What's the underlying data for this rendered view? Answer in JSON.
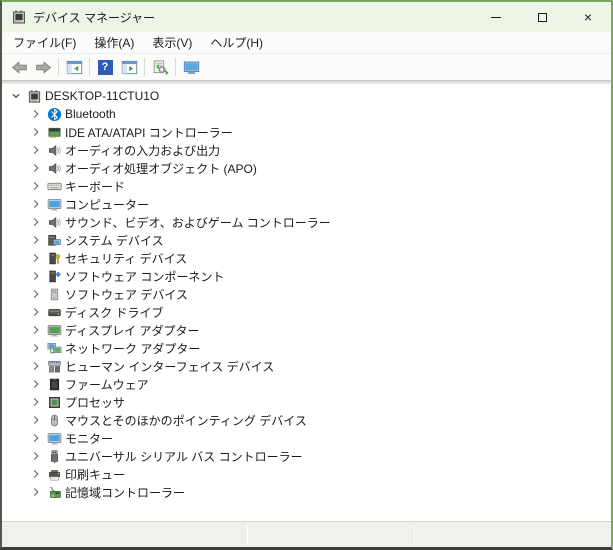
{
  "window": {
    "title": "デバイス マネージャー",
    "controls": {
      "minimize": "minimize",
      "maximize": "maximize",
      "close": "close"
    },
    "colors": {
      "border_green": "#7aa85a",
      "titlebar_bg": "#edf5e6",
      "tree_bg": "#ffffff",
      "statusbar_bg": "#f0f0ec",
      "text": "#1b1b1b",
      "bluetooth_blue": "#0078d4",
      "help_blue": "#2f5bb7"
    }
  },
  "menu": {
    "items": [
      {
        "name": "file",
        "label": "ファイル(F)"
      },
      {
        "name": "action",
        "label": "操作(A)"
      },
      {
        "name": "view",
        "label": "表示(V)"
      },
      {
        "name": "help",
        "label": "ヘルプ(H)"
      }
    ]
  },
  "toolbar": {
    "groups": [
      {
        "buttons": [
          {
            "name": "back",
            "icon": "nav-back"
          },
          {
            "name": "forward",
            "icon": "nav-forward"
          }
        ]
      },
      {
        "buttons": [
          {
            "name": "show-console-tree",
            "icon": "panel-left"
          }
        ]
      },
      {
        "buttons": [
          {
            "name": "help",
            "icon": "help"
          },
          {
            "name": "show-action-pane",
            "icon": "panel-right"
          }
        ]
      },
      {
        "buttons": [
          {
            "name": "scan-hardware-changes",
            "icon": "scan"
          }
        ]
      },
      {
        "buttons": [
          {
            "name": "computer",
            "icon": "remote-monitor"
          }
        ]
      }
    ]
  },
  "tree": {
    "root": {
      "name": "desktop-root",
      "label": "DESKTOP-11CTU1O",
      "icon": "computer-device",
      "expanded": true
    },
    "items": [
      {
        "name": "bluetooth",
        "label": "Bluetooth",
        "icon": "bluetooth"
      },
      {
        "name": "ide-ata-atapi",
        "label": "IDE ATA/ATAPI コントローラー",
        "icon": "ide"
      },
      {
        "name": "audio-inputs-outputs",
        "label": "オーディオの入力および出力",
        "icon": "audio"
      },
      {
        "name": "audio-processing",
        "label": "オーディオ処理オブジェクト (APO)",
        "icon": "audio"
      },
      {
        "name": "keyboards",
        "label": "キーボード",
        "icon": "keyboard"
      },
      {
        "name": "computer",
        "label": "コンピューター",
        "icon": "monitor"
      },
      {
        "name": "sound-video-game",
        "label": "サウンド、ビデオ、およびゲーム コントローラー",
        "icon": "audio"
      },
      {
        "name": "system-devices",
        "label": "システム デバイス",
        "icon": "system"
      },
      {
        "name": "security-devices",
        "label": "セキュリティ デバイス",
        "icon": "security"
      },
      {
        "name": "software-components",
        "label": "ソフトウェア コンポーネント",
        "icon": "software-component"
      },
      {
        "name": "software-devices",
        "label": "ソフトウェア デバイス",
        "icon": "software-device"
      },
      {
        "name": "disk-drives",
        "label": "ディスク ドライブ",
        "icon": "disk"
      },
      {
        "name": "display-adapters",
        "label": "ディスプレイ アダプター",
        "icon": "display"
      },
      {
        "name": "network-adapters",
        "label": "ネットワーク アダプター",
        "icon": "network"
      },
      {
        "name": "human-interface",
        "label": "ヒューマン インターフェイス デバイス",
        "icon": "hid"
      },
      {
        "name": "firmware",
        "label": "ファームウェア",
        "icon": "firmware"
      },
      {
        "name": "processors",
        "label": "プロセッサ",
        "icon": "processor"
      },
      {
        "name": "mice-pointing",
        "label": "マウスとそのほかのポインティング デバイス",
        "icon": "mouse"
      },
      {
        "name": "monitors",
        "label": "モニター",
        "icon": "monitor"
      },
      {
        "name": "usb-controllers",
        "label": "ユニバーサル シリアル バス コントローラー",
        "icon": "usb"
      },
      {
        "name": "print-queues",
        "label": "印刷キュー",
        "icon": "printer"
      },
      {
        "name": "storage-controllers",
        "label": "記憶域コントローラー",
        "icon": "storage"
      }
    ]
  },
  "statusbar": {
    "sections": [
      "",
      "",
      ""
    ]
  }
}
